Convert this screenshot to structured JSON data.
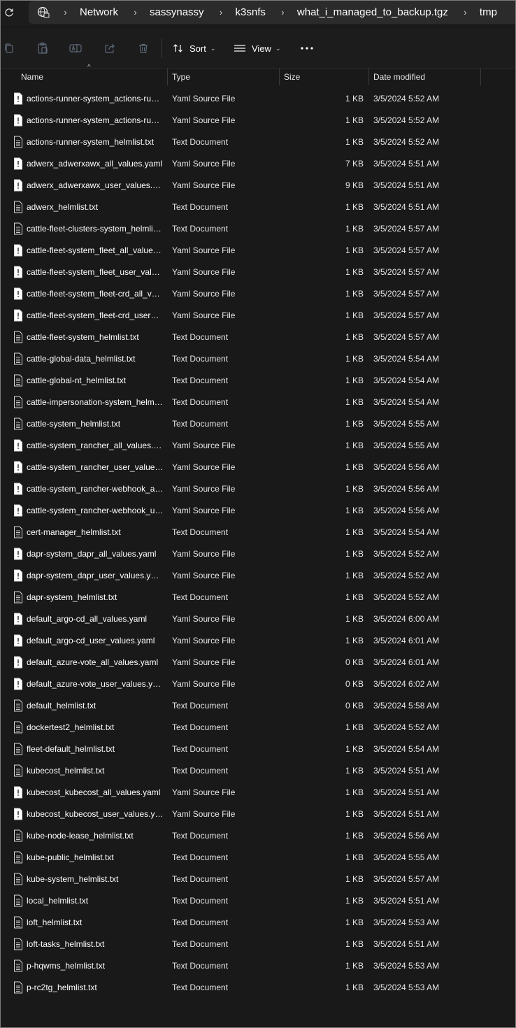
{
  "breadcrumb": [
    "Network",
    "sassynassy",
    "k3snfs",
    "what_i_managed_to_backup.tgz",
    "tmp"
  ],
  "toolbar": {
    "sort_label": "Sort",
    "view_label": "View",
    "icons": [
      "copy-icon",
      "paste-icon",
      "rename-icon",
      "share-icon",
      "delete-icon"
    ]
  },
  "columns": {
    "name": "Name",
    "type": "Type",
    "size": "Size",
    "date": "Date modified"
  },
  "files": [
    {
      "name": "actions-runner-system_actions-runner-controller_all_values.yaml",
      "type": "Yaml Source File",
      "size": "1 KB",
      "date": "3/5/2024 5:52 AM",
      "kind": "yaml"
    },
    {
      "name": "actions-runner-system_actions-runner-controller_user_values.yaml",
      "type": "Yaml Source File",
      "size": "1 KB",
      "date": "3/5/2024 5:52 AM",
      "kind": "yaml"
    },
    {
      "name": "actions-runner-system_helmlist.txt",
      "type": "Text Document",
      "size": "1 KB",
      "date": "3/5/2024 5:52 AM",
      "kind": "txt"
    },
    {
      "name": "adwerx_adwerxawx_all_values.yaml",
      "type": "Yaml Source File",
      "size": "7 KB",
      "date": "3/5/2024 5:51 AM",
      "kind": "yaml"
    },
    {
      "name": "adwerx_adwerxawx_user_values.yaml",
      "type": "Yaml Source File",
      "size": "9 KB",
      "date": "3/5/2024 5:51 AM",
      "kind": "yaml"
    },
    {
      "name": "adwerx_helmlist.txt",
      "type": "Text Document",
      "size": "1 KB",
      "date": "3/5/2024 5:51 AM",
      "kind": "txt"
    },
    {
      "name": "cattle-fleet-clusters-system_helmlist.txt",
      "type": "Text Document",
      "size": "1 KB",
      "date": "3/5/2024 5:57 AM",
      "kind": "txt"
    },
    {
      "name": "cattle-fleet-system_fleet_all_values.yaml",
      "type": "Yaml Source File",
      "size": "1 KB",
      "date": "3/5/2024 5:57 AM",
      "kind": "yaml"
    },
    {
      "name": "cattle-fleet-system_fleet_user_values.yaml",
      "type": "Yaml Source File",
      "size": "1 KB",
      "date": "3/5/2024 5:57 AM",
      "kind": "yaml"
    },
    {
      "name": "cattle-fleet-system_fleet-crd_all_values.yaml",
      "type": "Yaml Source File",
      "size": "1 KB",
      "date": "3/5/2024 5:57 AM",
      "kind": "yaml"
    },
    {
      "name": "cattle-fleet-system_fleet-crd_user_values.yaml",
      "type": "Yaml Source File",
      "size": "1 KB",
      "date": "3/5/2024 5:57 AM",
      "kind": "yaml"
    },
    {
      "name": "cattle-fleet-system_helmlist.txt",
      "type": "Text Document",
      "size": "1 KB",
      "date": "3/5/2024 5:57 AM",
      "kind": "txt"
    },
    {
      "name": "cattle-global-data_helmlist.txt",
      "type": "Text Document",
      "size": "1 KB",
      "date": "3/5/2024 5:54 AM",
      "kind": "txt"
    },
    {
      "name": "cattle-global-nt_helmlist.txt",
      "type": "Text Document",
      "size": "1 KB",
      "date": "3/5/2024 5:54 AM",
      "kind": "txt"
    },
    {
      "name": "cattle-impersonation-system_helmlist.txt",
      "type": "Text Document",
      "size": "1 KB",
      "date": "3/5/2024 5:54 AM",
      "kind": "txt"
    },
    {
      "name": "cattle-system_helmlist.txt",
      "type": "Text Document",
      "size": "1 KB",
      "date": "3/5/2024 5:55 AM",
      "kind": "txt"
    },
    {
      "name": "cattle-system_rancher_all_values.yaml",
      "type": "Yaml Source File",
      "size": "1 KB",
      "date": "3/5/2024 5:55 AM",
      "kind": "yaml"
    },
    {
      "name": "cattle-system_rancher_user_values.yaml",
      "type": "Yaml Source File",
      "size": "1 KB",
      "date": "3/5/2024 5:56 AM",
      "kind": "yaml"
    },
    {
      "name": "cattle-system_rancher-webhook_all_values.yaml",
      "type": "Yaml Source File",
      "size": "1 KB",
      "date": "3/5/2024 5:56 AM",
      "kind": "yaml"
    },
    {
      "name": "cattle-system_rancher-webhook_user_values.yaml",
      "type": "Yaml Source File",
      "size": "1 KB",
      "date": "3/5/2024 5:56 AM",
      "kind": "yaml"
    },
    {
      "name": "cert-manager_helmlist.txt",
      "type": "Text Document",
      "size": "1 KB",
      "date": "3/5/2024 5:54 AM",
      "kind": "txt"
    },
    {
      "name": "dapr-system_dapr_all_values.yaml",
      "type": "Yaml Source File",
      "size": "1 KB",
      "date": "3/5/2024 5:52 AM",
      "kind": "yaml"
    },
    {
      "name": "dapr-system_dapr_user_values.yaml",
      "type": "Yaml Source File",
      "size": "1 KB",
      "date": "3/5/2024 5:52 AM",
      "kind": "yaml"
    },
    {
      "name": "dapr-system_helmlist.txt",
      "type": "Text Document",
      "size": "1 KB",
      "date": "3/5/2024 5:52 AM",
      "kind": "txt"
    },
    {
      "name": "default_argo-cd_all_values.yaml",
      "type": "Yaml Source File",
      "size": "1 KB",
      "date": "3/5/2024 6:00 AM",
      "kind": "yaml"
    },
    {
      "name": "default_argo-cd_user_values.yaml",
      "type": "Yaml Source File",
      "size": "1 KB",
      "date": "3/5/2024 6:01 AM",
      "kind": "yaml"
    },
    {
      "name": "default_azure-vote_all_values.yaml",
      "type": "Yaml Source File",
      "size": "0 KB",
      "date": "3/5/2024 6:01 AM",
      "kind": "yaml"
    },
    {
      "name": "default_azure-vote_user_values.yaml",
      "type": "Yaml Source File",
      "size": "0 KB",
      "date": "3/5/2024 6:02 AM",
      "kind": "yaml"
    },
    {
      "name": "default_helmlist.txt",
      "type": "Text Document",
      "size": "0 KB",
      "date": "3/5/2024 5:58 AM",
      "kind": "txt"
    },
    {
      "name": "dockertest2_helmlist.txt",
      "type": "Text Document",
      "size": "1 KB",
      "date": "3/5/2024 5:52 AM",
      "kind": "txt"
    },
    {
      "name": "fleet-default_helmlist.txt",
      "type": "Text Document",
      "size": "1 KB",
      "date": "3/5/2024 5:54 AM",
      "kind": "txt"
    },
    {
      "name": "kubecost_helmlist.txt",
      "type": "Text Document",
      "size": "1 KB",
      "date": "3/5/2024 5:51 AM",
      "kind": "txt"
    },
    {
      "name": "kubecost_kubecost_all_values.yaml",
      "type": "Yaml Source File",
      "size": "1 KB",
      "date": "3/5/2024 5:51 AM",
      "kind": "yaml"
    },
    {
      "name": "kubecost_kubecost_user_values.yaml",
      "type": "Yaml Source File",
      "size": "1 KB",
      "date": "3/5/2024 5:51 AM",
      "kind": "yaml"
    },
    {
      "name": "kube-node-lease_helmlist.txt",
      "type": "Text Document",
      "size": "1 KB",
      "date": "3/5/2024 5:56 AM",
      "kind": "txt"
    },
    {
      "name": "kube-public_helmlist.txt",
      "type": "Text Document",
      "size": "1 KB",
      "date": "3/5/2024 5:55 AM",
      "kind": "txt"
    },
    {
      "name": "kube-system_helmlist.txt",
      "type": "Text Document",
      "size": "1 KB",
      "date": "3/5/2024 5:57 AM",
      "kind": "txt"
    },
    {
      "name": "local_helmlist.txt",
      "type": "Text Document",
      "size": "1 KB",
      "date": "3/5/2024 5:51 AM",
      "kind": "txt"
    },
    {
      "name": "loft_helmlist.txt",
      "type": "Text Document",
      "size": "1 KB",
      "date": "3/5/2024 5:53 AM",
      "kind": "txt"
    },
    {
      "name": "loft-tasks_helmlist.txt",
      "type": "Text Document",
      "size": "1 KB",
      "date": "3/5/2024 5:51 AM",
      "kind": "txt"
    },
    {
      "name": "p-hqwms_helmlist.txt",
      "type": "Text Document",
      "size": "1 KB",
      "date": "3/5/2024 5:53 AM",
      "kind": "txt"
    },
    {
      "name": "p-rc2tg_helmlist.txt",
      "type": "Text Document",
      "size": "1 KB",
      "date": "3/5/2024 5:53 AM",
      "kind": "txt"
    }
  ],
  "colors": {
    "background": "#191919",
    "toolbar": "#1c1c1c",
    "address_bar": "#2b2b2b",
    "text": "#ffffff"
  }
}
